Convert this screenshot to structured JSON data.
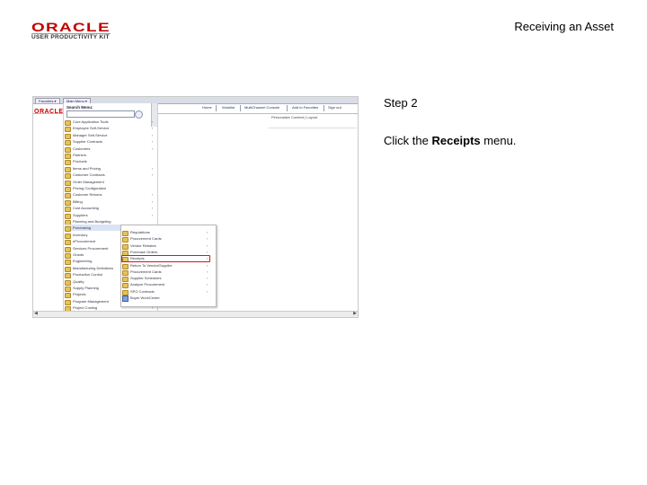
{
  "header": {
    "logo_brand": "ORACLE",
    "logo_product": "USER PRODUCTIVITY KIT",
    "doc_title": "Receiving an Asset"
  },
  "step": {
    "label": "Step 2",
    "instruction_prefix": "Click the ",
    "instruction_bold": "Receipts",
    "instruction_suffix": " menu."
  },
  "screenshot": {
    "tabs": [
      "Favorites ▾",
      "Main Menu ▾"
    ],
    "brand": "ORACLE",
    "nav_links": [
      "Home",
      "Worklist",
      "MultiChannel Console",
      "Add to Favorites",
      "Sign out"
    ],
    "search_label": "Search Menu:",
    "content_header": "Personalize Content | Layout",
    "menu_items": [
      {
        "label": "Core Application Tools",
        "arrow": true
      },
      {
        "label": "Employee Self-Service",
        "arrow": true
      },
      {
        "label": "Manager Self-Service",
        "arrow": true
      },
      {
        "label": "Supplier Contracts",
        "arrow": true
      },
      {
        "label": "Customers",
        "arrow": true
      },
      {
        "label": "Partners",
        "arrow": false
      },
      {
        "label": "Products",
        "arrow": false
      },
      {
        "label": "Items and Pricing",
        "arrow": true
      },
      {
        "label": "Customer Contracts",
        "arrow": true
      },
      {
        "label": "Order Management",
        "arrow": false
      },
      {
        "label": "Pricing Configuration",
        "arrow": false
      },
      {
        "label": "Customer Returns",
        "arrow": true
      },
      {
        "label": "Billing",
        "arrow": true
      },
      {
        "label": "Cost Accounting",
        "arrow": true
      },
      {
        "label": "Suppliers",
        "arrow": true
      },
      {
        "label": "Planning and Budgeting",
        "arrow": false
      },
      {
        "label": "Purchasing",
        "arrow": true
      },
      {
        "label": "Inventory",
        "arrow": true
      },
      {
        "label": "eProcurement",
        "arrow": true
      },
      {
        "label": "Services Procurement",
        "arrow": true
      },
      {
        "label": "Grants",
        "arrow": true
      },
      {
        "label": "Engineering",
        "arrow": true
      },
      {
        "label": "Manufacturing Definitions",
        "arrow": true
      },
      {
        "label": "Production Control",
        "arrow": true
      },
      {
        "label": "Quality",
        "arrow": true
      },
      {
        "label": "Supply Planning",
        "arrow": true
      },
      {
        "label": "Projects",
        "arrow": true
      },
      {
        "label": "Program Management",
        "arrow": true
      },
      {
        "label": "Project Costing",
        "arrow": true
      }
    ],
    "submenu_items": [
      {
        "label": "Requisitions",
        "arrow": true,
        "icon": "folder"
      },
      {
        "label": "Procurement Cards",
        "arrow": true,
        "icon": "folder"
      },
      {
        "label": "Vendor Rebates",
        "arrow": true,
        "icon": "folder"
      },
      {
        "label": "Purchase Orders",
        "arrow": true,
        "icon": "folder"
      },
      {
        "label": "Receipts",
        "arrow": true,
        "icon": "folder"
      },
      {
        "label": "Return To Vendor/Supplier",
        "arrow": true,
        "icon": "folder"
      },
      {
        "label": "Procurement Cards",
        "arrow": true,
        "icon": "folder"
      },
      {
        "label": "Supplier Schedules",
        "arrow": true,
        "icon": "folder"
      },
      {
        "label": "Analyze Procurement",
        "arrow": true,
        "icon": "folder"
      },
      {
        "label": "SPG Contracts",
        "arrow": true,
        "icon": "folder"
      },
      {
        "label": "Buyer WorkCenter",
        "arrow": false,
        "icon": "page"
      }
    ],
    "highlighted_item": "Receipts",
    "colors": {
      "brand_red": "#c00000",
      "highlight_red": "#d01818",
      "folder_yellow": "#e6c25a"
    }
  }
}
